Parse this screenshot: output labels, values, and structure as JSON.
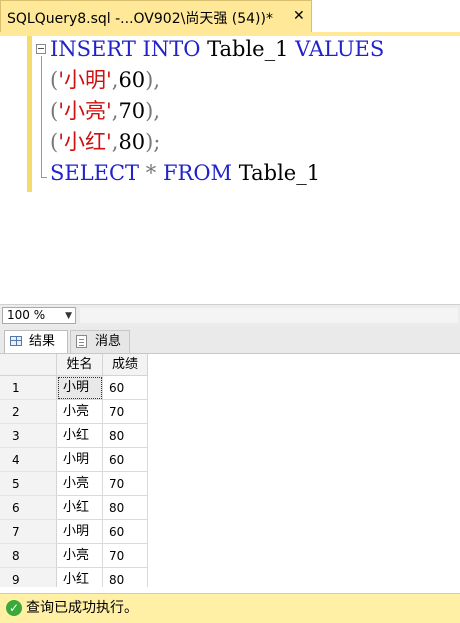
{
  "tab": {
    "title": "SQLQuery8.sql -...OV902\\尚天强 (54))*",
    "close_glyph": "✕"
  },
  "editor": {
    "lines": [
      [
        {
          "t": "INSERT",
          "c": "kw"
        },
        {
          "t": " ",
          "c": "num"
        },
        {
          "t": "INTO",
          "c": "kw"
        },
        {
          "t": " Table_1 ",
          "c": "num"
        },
        {
          "t": "VALUES",
          "c": "kw"
        }
      ],
      [
        {
          "t": "(",
          "c": "gr"
        },
        {
          "t": "'小明'",
          "c": "str"
        },
        {
          "t": ",",
          "c": "gr"
        },
        {
          "t": "60",
          "c": "num"
        },
        {
          "t": "),",
          "c": "gr"
        }
      ],
      [
        {
          "t": "(",
          "c": "gr"
        },
        {
          "t": "'小亮'",
          "c": "str"
        },
        {
          "t": ",",
          "c": "gr"
        },
        {
          "t": "70",
          "c": "num"
        },
        {
          "t": "),",
          "c": "gr"
        }
      ],
      [
        {
          "t": "(",
          "c": "gr"
        },
        {
          "t": "'小红'",
          "c": "str"
        },
        {
          "t": ",",
          "c": "gr"
        },
        {
          "t": "80",
          "c": "num"
        },
        {
          "t": ");",
          "c": "gr"
        }
      ],
      [
        {
          "t": "SELECT",
          "c": "kw"
        },
        {
          "t": " ",
          "c": "num"
        },
        {
          "t": "*",
          "c": "gr"
        },
        {
          "t": " ",
          "c": "num"
        },
        {
          "t": "FROM",
          "c": "kw"
        },
        {
          "t": " Table_1",
          "c": "num"
        }
      ]
    ]
  },
  "zoom": {
    "value": "100 %"
  },
  "results_tabs": {
    "results": "结果",
    "messages": "消息"
  },
  "grid": {
    "columns": [
      "姓名",
      "成绩"
    ],
    "rows": [
      {
        "n": "1",
        "name": "小明",
        "score": "60"
      },
      {
        "n": "2",
        "name": "小亮",
        "score": "70"
      },
      {
        "n": "3",
        "name": "小红",
        "score": "80"
      },
      {
        "n": "4",
        "name": "小明",
        "score": "60"
      },
      {
        "n": "5",
        "name": "小亮",
        "score": "70"
      },
      {
        "n": "6",
        "name": "小红",
        "score": "80"
      },
      {
        "n": "7",
        "name": "小明",
        "score": "60"
      },
      {
        "n": "8",
        "name": "小亮",
        "score": "70"
      },
      {
        "n": "9",
        "name": "小红",
        "score": "80"
      }
    ]
  },
  "status": {
    "text": "查询已成功执行。"
  },
  "colors": {
    "tab_bg": "#ffe999",
    "keyword": "#2222cc",
    "string": "#cc1111",
    "status_bg": "#fff0a5",
    "ok": "#3aa83a"
  }
}
